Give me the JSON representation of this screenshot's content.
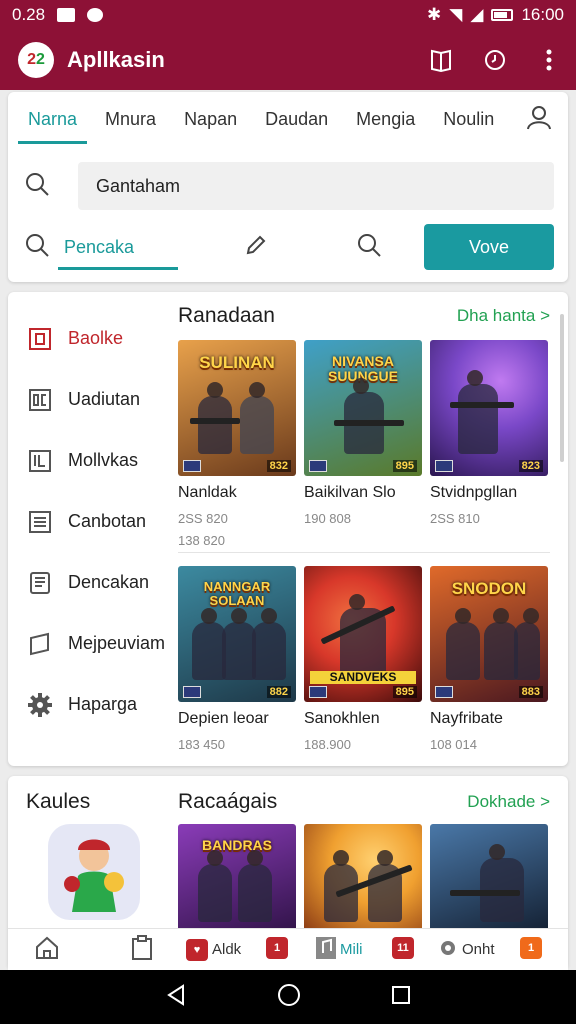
{
  "status_bar": {
    "time": "0.28",
    "clock": "16:00"
  },
  "app_bar": {
    "title": "Apllkasin",
    "logo_text": "2",
    "logo_text_2": "2"
  },
  "tabs": [
    "Narna",
    "Mnura",
    "Napan",
    "Daudan",
    "Mengia",
    "Noulin"
  ],
  "search": {
    "value": "Gantaham"
  },
  "action_row": {
    "tab_label": "Pencaka",
    "button_label": "Vove"
  },
  "sidebar": [
    {
      "label": "Baolke",
      "icon": "square-icon"
    },
    {
      "label": "Uadiutan",
      "icon": "dc-icon"
    },
    {
      "label": "Mollvkas",
      "icon": "document-icon"
    },
    {
      "label": "Canbotan",
      "icon": "list-icon"
    },
    {
      "label": "Dencakan",
      "icon": "receipt-icon"
    },
    {
      "label": "Mejpeuviam",
      "icon": "bookmark-icon"
    },
    {
      "label": "Haparga",
      "icon": "gear-icon"
    }
  ],
  "section1": {
    "title": "Ranadaan",
    "link": "Dha hanta >"
  },
  "section2": {
    "title": "Racaágais",
    "link": "Dokhade >"
  },
  "games_row1": [
    {
      "title": "SULINAN",
      "name": "Nanldak",
      "meta1": "2SS 820",
      "meta2": "138 820",
      "badge": "832",
      "grad": "#e8a14b,#6a3a1c"
    },
    {
      "title": "NIVANSA SUUNGUE",
      "name": "Baikilvan Slo",
      "meta1": "190 808",
      "meta2": "",
      "badge": "895",
      "grad": "#3fa0c8,#5a7a2a"
    },
    {
      "title": "",
      "name": "Stvidnpgllan",
      "meta1": "2SS 810",
      "meta2": "",
      "badge": "823",
      "grad": "#7a48c8,#2a1650"
    }
  ],
  "games_row2": [
    {
      "title": "NANNGAR SOLAAN",
      "name": "Depien leoar",
      "meta1": "183 450",
      "meta2": "",
      "badge": "882",
      "grad": "#3c8aa0,#1e3848"
    },
    {
      "title": "SANDVEKS",
      "name": "Sanokhlen",
      "meta1": "188.900",
      "meta2": "",
      "badge": "895",
      "grad": "#d8382a,#3a0a0a"
    },
    {
      "title": "SNODON",
      "name": "Nayfribate",
      "meta1": "108 014",
      "meta2": "",
      "badge": "883",
      "grad": "#e06a2a,#4a1820"
    }
  ],
  "games_row3": [
    {
      "title": "BANDRAS",
      "grad": "#8a3cb8,#2a1040"
    },
    {
      "title": "",
      "grad": "#f0a030,#7a2a10"
    },
    {
      "title": "",
      "grad": "#4a78a8,#101a2a"
    }
  ],
  "kaules": {
    "title": "Kaules"
  },
  "bottom_nav": {
    "item3": "Aldk",
    "item4": "Mili",
    "item5": "Onht",
    "badge3": "1",
    "badge4": "11",
    "badge5": "1"
  },
  "colors": {
    "primary": "#8d1136",
    "accent": "#1a9a9a",
    "link": "#22a152",
    "active": "#c0262c"
  }
}
